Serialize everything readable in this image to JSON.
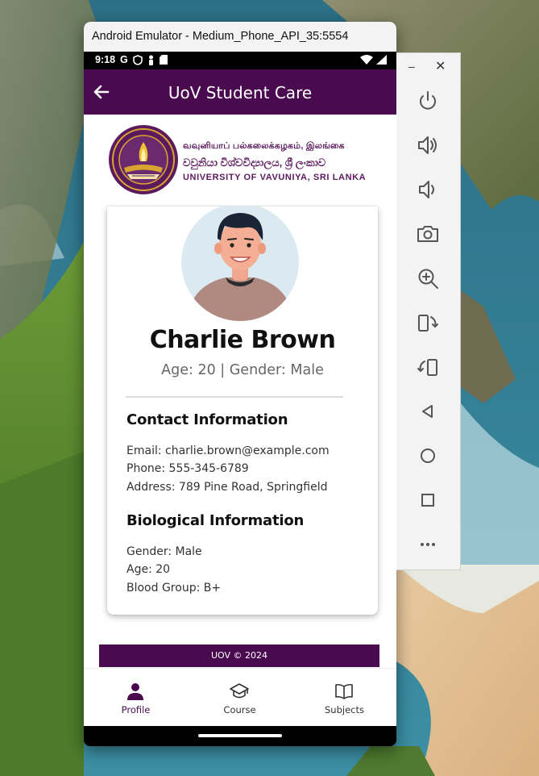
{
  "window": {
    "title": "Android Emulator - Medium_Phone_API_35:5554"
  },
  "status_bar": {
    "time": "9:18",
    "google_glyph": "G"
  },
  "app_bar": {
    "title": "UoV Student Care"
  },
  "university": {
    "name_tamil": "வவுனியாப் பல்கலைக்கழகம், இலங்கை",
    "name_sinhala": "වවුනියා විශ්වවිද්‍යාලය, ශ්‍රී ලංකාව",
    "name_english": "UNIVERSITY OF VAVUNIYA, SRI LANKA"
  },
  "profile": {
    "name": "Charlie Brown",
    "summary": "Age: 20 | Gender: Male",
    "contact": {
      "title": "Contact Information",
      "email": "Email: charlie.brown@example.com",
      "phone": "Phone: 555-345-6789",
      "address": "Address: 789 Pine Road, Springfield"
    },
    "biological": {
      "title": "Biological Information",
      "gender": "Gender: Male",
      "age": "Age: 20",
      "blood_group": "Blood Group: B+"
    }
  },
  "footer": {
    "text": "UOV ©  2024"
  },
  "bottom_nav": {
    "items": [
      {
        "label": "Profile",
        "icon": "person-icon",
        "active": true
      },
      {
        "label": "Course",
        "icon": "graduation-cap-icon",
        "active": false
      },
      {
        "label": "Subjects",
        "icon": "book-icon",
        "active": false
      }
    ]
  },
  "toolbar": {
    "minimize_glyph": "–",
    "close_glyph": "✕",
    "buttons": [
      "power-icon",
      "volume-up-icon",
      "volume-down-icon",
      "camera-icon",
      "zoom-icon",
      "rotate-left-icon",
      "rotate-right-icon",
      "back-icon",
      "home-icon",
      "overview-icon",
      "more-icon"
    ]
  },
  "colors": {
    "primary": "#4a0a4f",
    "nav_active": "#4a0a4f",
    "nav_inactive": "#333333",
    "background": "#ffffff"
  }
}
